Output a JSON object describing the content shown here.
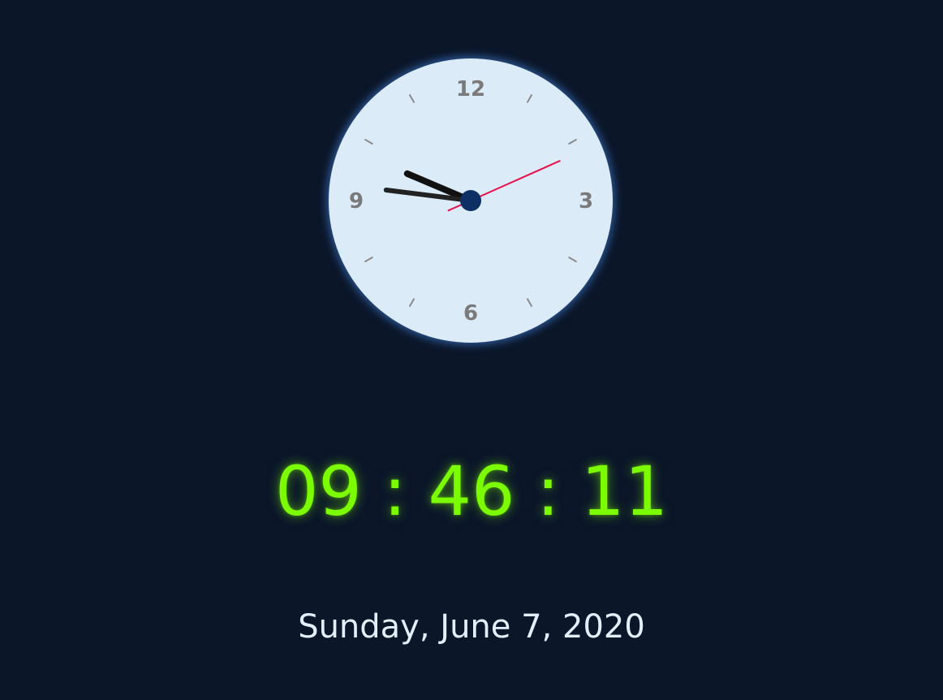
{
  "clock": {
    "numbers": {
      "twelve": "12",
      "three": "3",
      "six": "6",
      "nine": "9"
    },
    "time": {
      "hours": 9,
      "minutes": 46,
      "seconds": 11
    },
    "colors": {
      "face": "#dcebf8",
      "hour_hand": "#111111",
      "minute_hand": "#222222",
      "second_hand": "#e8104a",
      "center_cap": "#0d2f66",
      "glow": "#468ceb"
    }
  },
  "digital": {
    "hours": "09",
    "separator_1": ":",
    "minutes": "46",
    "separator_2": ":",
    "seconds": "11",
    "color": "#7cfc00"
  },
  "date": {
    "text": "Sunday, June 7, 2020"
  },
  "background_color": "#0b1629"
}
